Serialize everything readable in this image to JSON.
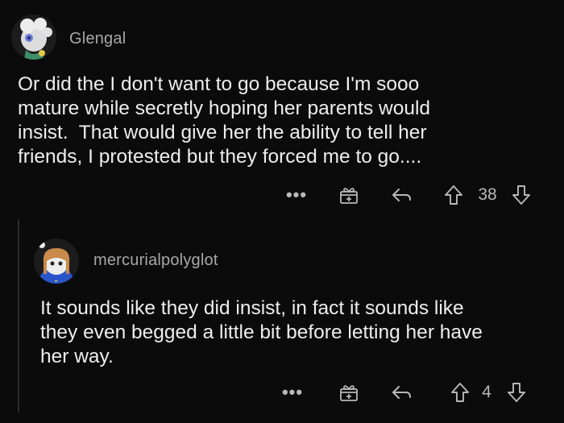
{
  "comments": [
    {
      "username": "Glengal",
      "body": "Or did the I don't want to go because I'm sooo\nmature while secretly hoping her parents would\ninsist.  That would give her the ability to tell her\nfriends, I protested but they forced me to go....",
      "actions": {
        "more_label": "•••",
        "score": "38"
      }
    },
    {
      "username": "mercurialpolyglot",
      "body": "It sounds like they did insist, in fact it sounds like\nthey even begged a little bit before letting her have\nher way.",
      "actions": {
        "more_label": "•••",
        "score": "4"
      }
    }
  ],
  "icons": {
    "award": "gift-award-icon",
    "reply": "reply-arrow-icon",
    "upvote": "upvote-arrow-icon",
    "downvote": "downvote-arrow-icon"
  }
}
